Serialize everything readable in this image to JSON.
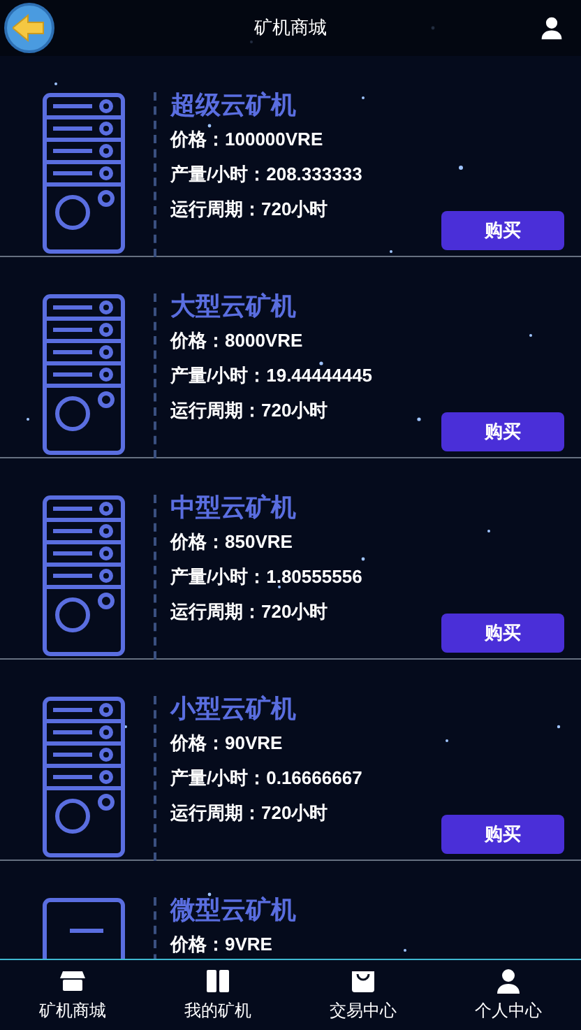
{
  "header": {
    "title": "矿机商城"
  },
  "machines": [
    {
      "kind": "rack",
      "title": "超级云矿机",
      "price": "价格：100000VRE",
      "output": "产量/小时：208.333333",
      "period": "运行周期：720小时",
      "button": "购买"
    },
    {
      "kind": "rack",
      "title": "大型云矿机",
      "price": "价格：8000VRE",
      "output": "产量/小时：19.44444445",
      "period": "运行周期：720小时",
      "button": "购买"
    },
    {
      "kind": "rack",
      "title": "中型云矿机",
      "price": "价格：850VRE",
      "output": "产量/小时：1.80555556",
      "period": "运行周期：720小时",
      "button": "购买"
    },
    {
      "kind": "rack",
      "title": "小型云矿机",
      "price": "价格：90VRE",
      "output": "产量/小时：0.16666667",
      "period": "运行周期：720小时",
      "button": "购买"
    },
    {
      "kind": "tower",
      "title": "微型云矿机",
      "price": "价格：9VRE"
    }
  ],
  "nav": [
    {
      "kind": "store",
      "label": "矿机商城"
    },
    {
      "kind": "book",
      "label": "我的矿机"
    },
    {
      "kind": "bag",
      "label": "交易中心"
    },
    {
      "kind": "person",
      "label": "个人中心"
    }
  ]
}
